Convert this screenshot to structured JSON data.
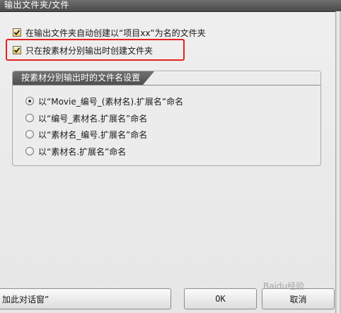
{
  "header": {
    "title": "输出文件夹/文件"
  },
  "options": {
    "auto_create_folder_label": "在输出文件夹自动创建以“项目xx”为名的文件夹",
    "create_folder_per_material_label": "只在按素材分别输出时创建文件夹"
  },
  "naming_group": {
    "title": "按素材分别输出时的文件名设置",
    "radios": [
      {
        "label": "以“Movie_编号_(素材名).扩展名”命名",
        "selected": true
      },
      {
        "label": "以“编号_素材名.扩展名”命名",
        "selected": false
      },
      {
        "label": "以“素材名_编号.扩展名”命名",
        "selected": false
      },
      {
        "label": "以“素材名.扩展名”命名",
        "selected": false
      }
    ]
  },
  "buttons": {
    "partial_label": "加此对话窗”",
    "ok_label": "OK",
    "cancel_label": "取消"
  },
  "watermark": {
    "text": "Baidu经验"
  },
  "colors": {
    "highlight": "#e52121",
    "checkbox_fill": "#f0c95a",
    "header_bg": "#555555"
  }
}
